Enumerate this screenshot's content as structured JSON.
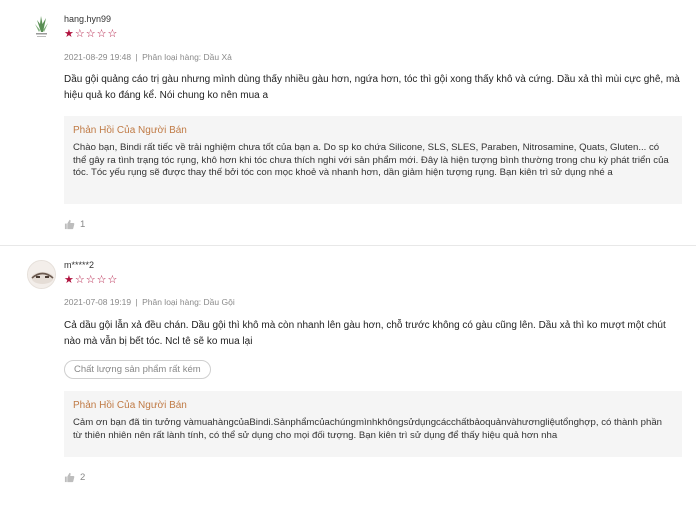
{
  "reviews": [
    {
      "username": "hang.hyn99",
      "rating": 1,
      "max_rating": 5,
      "stars": {
        "filled": "★",
        "empty": "☆☆☆☆"
      },
      "date": "2021-08-29 19:48",
      "separator": "|",
      "variant": "Phân loại hàng: Dầu Xả",
      "comment": "Dầu gội quảng cáo trị gàu nhưng mình dùng thấy nhiều gàu hơn, ngứa hơn, tóc thì gội xong thấy khô và cứng. Dầu xả thì mùi cực ghê, mà hiệu quả ko đáng kể. Nói chung ko nên mua a",
      "tag": "",
      "seller_reply": {
        "title": "Phản Hồi Của Người Bán",
        "text": "Chào bạn, Bindi rất tiếc về trải nghiệm chưa tốt của bạn a. Do sp ko chứa Silicone, SLS, SLES, Paraben, Nitrosamine, Quats, Gluten... có thể gây ra tình trạng tóc rụng, khô hơn khi tóc chưa thích nghi với sản phẩm mới. Đây là hiện tượng bình thường trong chu kỳ phát triển của tóc. Tóc yếu rụng sẽ được thay thế bởi tóc con mọc khoẻ và nhanh hơn, dần giảm hiện tượng rụng. Bạn kiên trì sử dụng nhé a"
      },
      "likes": "1"
    },
    {
      "username": "m*****2",
      "rating": 1,
      "max_rating": 5,
      "stars": {
        "filled": "★",
        "empty": "☆☆☆☆"
      },
      "date": "2021-07-08 19:19",
      "separator": "|",
      "variant": "Phân loại hàng: Dầu Gội",
      "comment": "Cả dầu gội lẫn xả đều chán. Dầu gội thì khô mà còn nhanh lên gàu hơn, chỗ trước không có gàu cũng lên. Dầu xả thì ko mượt một chút nào mà vẫn bị bết tóc. Ncl tê sẽ ko mua lại",
      "tag": "Chất lượng sản phẩm rất kém",
      "seller_reply": {
        "title": "Phản Hồi Của Người Bán",
        "text": "Cảm ơn bạn đã tin tưởng vàmuahàngcủaBindi.Sảnphẩmcủachúngmìnhkhôngsửdụngcácchấtbảoquảnvàhươngliệutổnghợp, có thành phần từ thiên nhiên nên rất lành tính, có thể sử dụng cho mọi đối tượng. Bạn kiên trì sử dụng để thấy hiệu quả hơn nha"
      },
      "likes": "2"
    }
  ],
  "icons": {
    "like": "thumbs-up-icon",
    "avatar_1": "plant-logo-avatar",
    "avatar_2": "user-photo-avatar"
  },
  "colors": {
    "star": "#b0123e",
    "reply_title": "#c07b46",
    "reply_bg": "#f5f5f5",
    "meta": "#8a8a8a"
  }
}
